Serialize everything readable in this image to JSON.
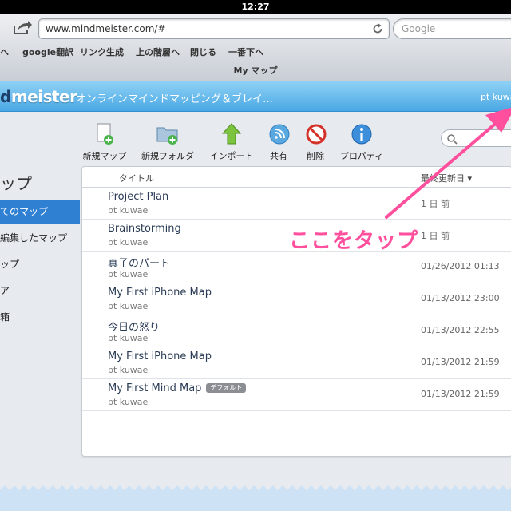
{
  "status_bar": {
    "time": "12:27"
  },
  "browser": {
    "url": "www.mindmeister.com/#",
    "search_placeholder": "Google",
    "bookmarks": [
      "へ",
      "google翻訳",
      "リンク生成",
      "上の階層へ",
      "閉じる",
      "一番下へ"
    ],
    "page_title": "My マップ"
  },
  "header": {
    "logo_part1": "d",
    "logo_part2": "meister",
    "tagline": "オンラインマインドマッピング＆ブレイ…",
    "user": "pt kuwa"
  },
  "toolbar": {
    "items": [
      {
        "label": "新規マップ",
        "icon": "new-map-icon"
      },
      {
        "label": "新規フォルダ",
        "icon": "new-folder-icon"
      },
      {
        "label": "インポート",
        "icon": "import-icon"
      },
      {
        "label": "共有",
        "icon": "share-icon"
      },
      {
        "label": "削除",
        "icon": "delete-icon"
      },
      {
        "label": "プロパティ",
        "icon": "properties-icon"
      }
    ],
    "search_icon": "search-icon"
  },
  "sidebar": {
    "title": "ップ",
    "items": [
      {
        "label": "てのマップ",
        "active": true
      },
      {
        "label": "編集したマップ",
        "active": false
      },
      {
        "label": "ップ",
        "active": false
      },
      {
        "label": "ア",
        "active": false
      },
      {
        "label": "箱",
        "active": false
      }
    ]
  },
  "table": {
    "col_title": "タイトル",
    "col_date": "最終更新日 ▾",
    "rows": [
      {
        "title": "Project Plan",
        "owner": "pt kuwae",
        "date": "1 日 前"
      },
      {
        "title": "Brainstorming",
        "owner": "pt kuwae",
        "date": "1 日 前"
      },
      {
        "title": "真子のパート",
        "owner": "pt kuwae",
        "date": "01/26/2012 01:13"
      },
      {
        "title": "My First iPhone Map",
        "owner": "pt kuwae",
        "date": "01/13/2012 23:00"
      },
      {
        "title": "今日の怒り",
        "owner": "pt kuwae",
        "date": "01/13/2012 22:55"
      },
      {
        "title": "My First iPhone Map",
        "owner": "pt kuwae",
        "date": "01/13/2012 21:59"
      },
      {
        "title": "My First Mind Map",
        "owner": "pt kuwae",
        "date": "01/13/2012 21:59",
        "badge": "デフォルト"
      }
    ]
  },
  "annotation": {
    "text": "ここをタップ",
    "color": "#ff4f9d"
  }
}
